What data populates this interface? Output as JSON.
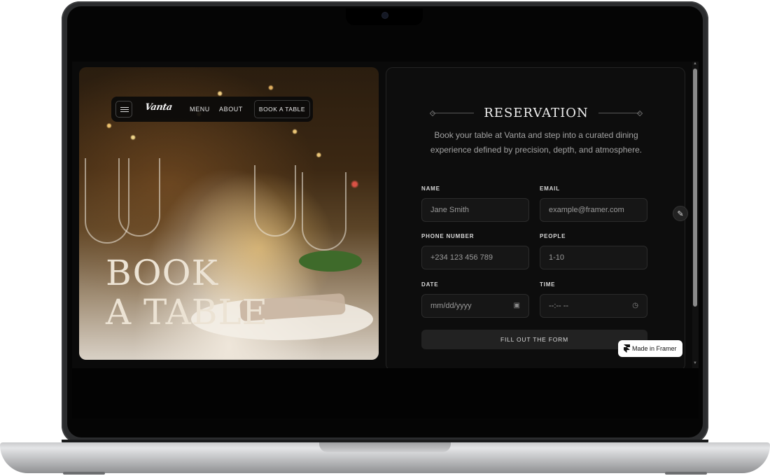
{
  "nav": {
    "logo": "Vanta",
    "links": [
      "MENU",
      "ABOUT"
    ],
    "cta": "BOOK A TABLE"
  },
  "hero": {
    "title_line1": "BOOK",
    "title_line2": "A TABLE"
  },
  "reservation": {
    "title": "RESERVATION",
    "description": "Book your table at Vanta and step into a curated dining experience defined by precision, depth, and atmosphere.",
    "fields": {
      "name": {
        "label": "NAME",
        "placeholder": "Jane Smith"
      },
      "email": {
        "label": "EMAIL",
        "placeholder": "example@framer.com"
      },
      "phone": {
        "label": "PHONE NUMBER",
        "placeholder": "+234 123 456 789"
      },
      "people": {
        "label": "PEOPLE",
        "placeholder": "1-10"
      },
      "date": {
        "label": "DATE",
        "placeholder": "mm/dd/yyyy",
        "icon": "calendar-icon"
      },
      "time": {
        "label": "TIME",
        "placeholder": "--:-- --",
        "icon": "clock-icon"
      }
    },
    "submit": "FILL OUT THE FORM"
  },
  "badge": {
    "label": "Made in Framer"
  },
  "colors": {
    "background": "#0a0a0a",
    "panel": "#0d0d0d",
    "accent": "#ece3d4"
  }
}
